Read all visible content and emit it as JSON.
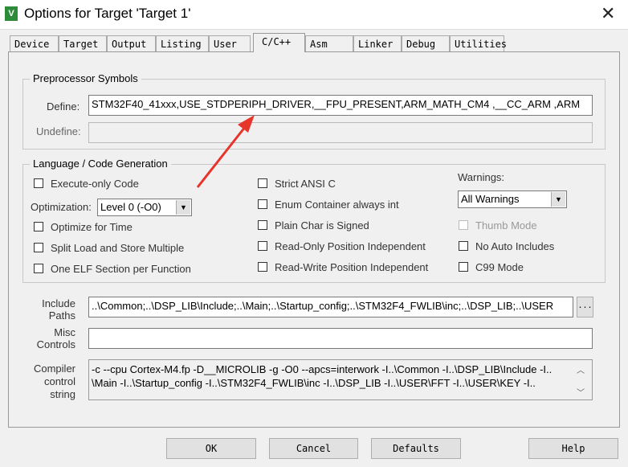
{
  "window": {
    "title": "Options for Target 'Target 1'",
    "logo_text": "μV"
  },
  "tabs": [
    {
      "label": "Device"
    },
    {
      "label": "Target"
    },
    {
      "label": "Output"
    },
    {
      "label": "Listing"
    },
    {
      "label": "User"
    },
    {
      "label": "C/C++",
      "active": true
    },
    {
      "label": "Asm"
    },
    {
      "label": "Linker"
    },
    {
      "label": "Debug"
    },
    {
      "label": "Utilities"
    }
  ],
  "preprocessor": {
    "title": "Preprocessor Symbols",
    "define_label": "Define:",
    "define_value": "STM32F40_41xxx,USE_STDPERIPH_DRIVER,__FPU_PRESENT,ARM_MATH_CM4 ,__CC_ARM ,ARM",
    "undefine_label": "Undefine:",
    "undefine_value": ""
  },
  "language": {
    "title": "Language / Code Generation",
    "execute_only": "Execute-only Code",
    "optimization_label": "Optimization:",
    "optimization_value": "Level 0 (-O0)",
    "optimize_time": "Optimize for Time",
    "split_load": "Split Load and Store Multiple",
    "one_elf": "One ELF Section per Function",
    "strict_ansi": "Strict ANSI C",
    "enum_container": "Enum Container always int",
    "plain_char": "Plain Char is Signed",
    "ro_pi": "Read-Only Position Independent",
    "rw_pi": "Read-Write Position Independent",
    "warnings_label": "Warnings:",
    "warnings_value": "All Warnings",
    "thumb_mode": "Thumb Mode",
    "no_auto_includes": "No Auto Includes",
    "c99_mode": "C99 Mode"
  },
  "include": {
    "label_1": "Include",
    "label_2": "Paths",
    "value": "..\\Common;..\\DSP_LIB\\Include;..\\Main;..\\Startup_config;..\\STM32F4_FWLIB\\inc;..\\DSP_LIB;..\\USER",
    "browse": "..."
  },
  "misc": {
    "label_1": "Misc",
    "label_2": "Controls",
    "value": ""
  },
  "compiler": {
    "label_1": "Compiler",
    "label_2": "control",
    "label_3": "string",
    "line_1": "-c --cpu Cortex-M4.fp -D__MICROLIB -g -O0 --apcs=interwork -I..\\Common -I..\\DSP_LIB\\Include -I..",
    "line_2": "\\Main -I..\\Startup_config -I..\\STM32F4_FWLIB\\inc -I..\\DSP_LIB -I..\\USER\\FFT -I..\\USER\\KEY -I.."
  },
  "buttons": {
    "ok": "OK",
    "cancel": "Cancel",
    "defaults": "Defaults",
    "help": "Help"
  },
  "annotation_color": "#e8352b"
}
